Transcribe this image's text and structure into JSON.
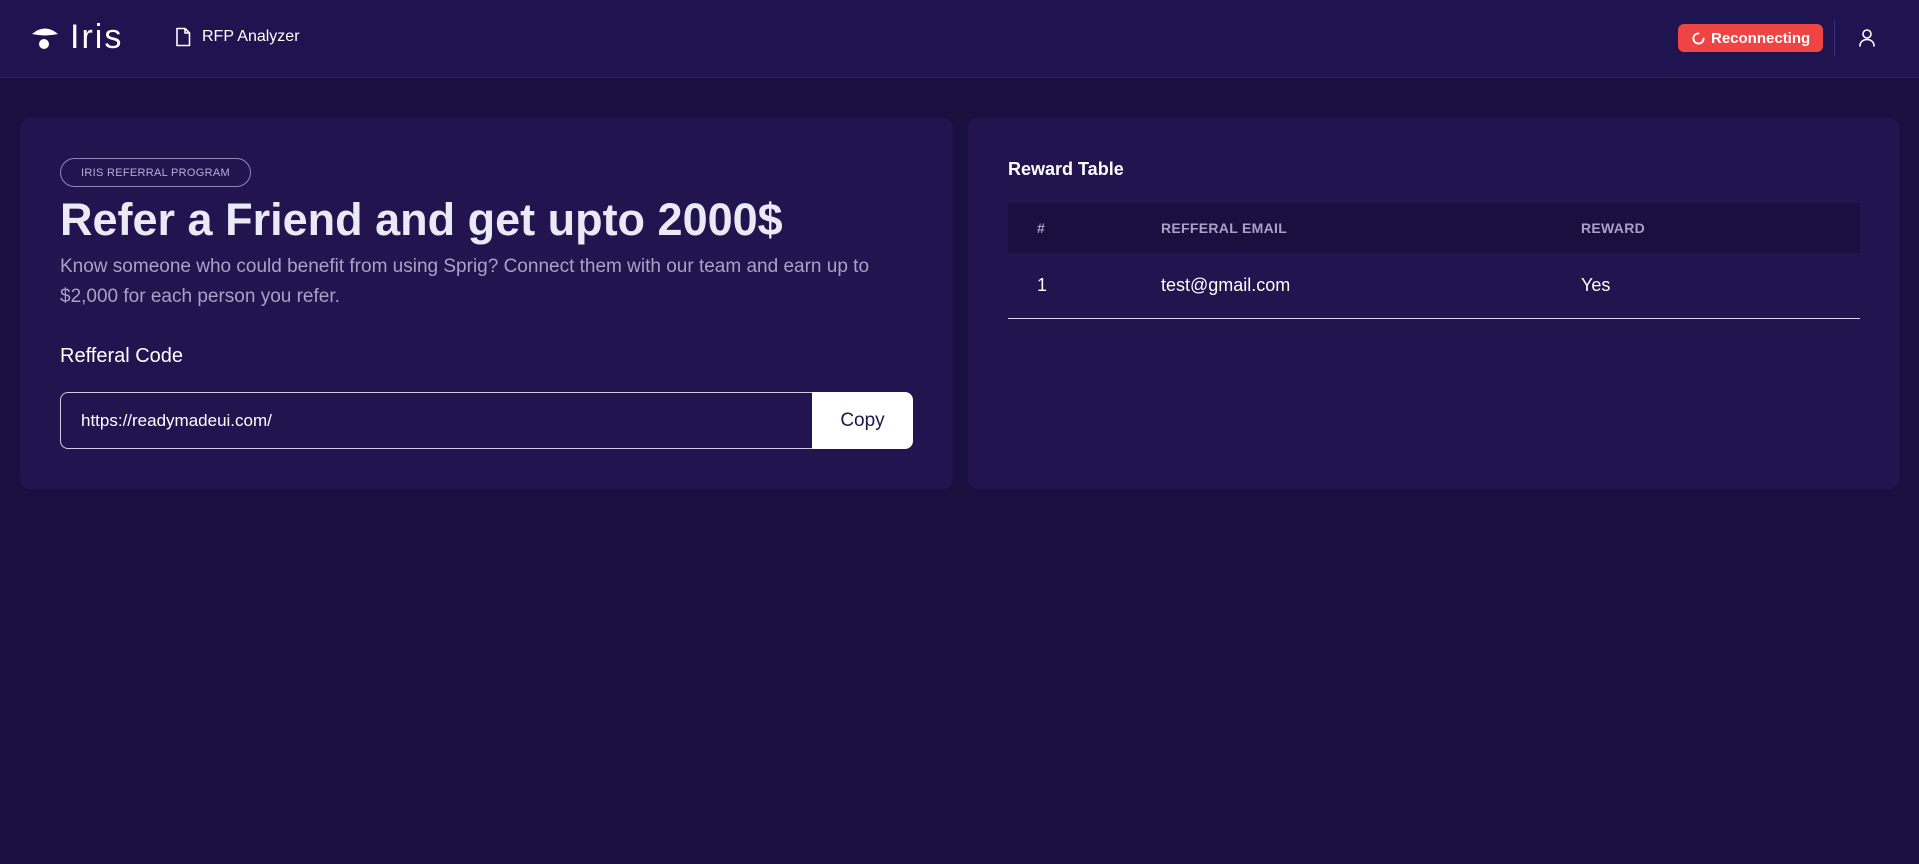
{
  "header": {
    "app_name": "Iris",
    "nav_item_label": "RFP Analyzer",
    "status_label": "Reconnecting",
    "status_color": "#ef4444"
  },
  "referral": {
    "tag": "IRIS REFERRAL PROGRAM",
    "headline": "Refer a Friend and get upto 2000$",
    "description": "Know someone who could benefit from using Sprig? Connect them with our team and earn up to $2,000 for each person you refer.",
    "code_label": "Refferal Code",
    "code_value": "https://readymadeui.com/",
    "copy_label": "Copy"
  },
  "reward_table": {
    "title": "Reward Table",
    "columns": [
      "#",
      "REFFERAL EMAIL",
      "REWARD"
    ],
    "rows": [
      {
        "index": "1",
        "email": "test@gmail.com",
        "reward": "Yes"
      }
    ]
  },
  "icons": {
    "logo": "iris-logo-icon",
    "nav": "document-icon",
    "status": "spinner-icon",
    "user": "user-icon"
  }
}
